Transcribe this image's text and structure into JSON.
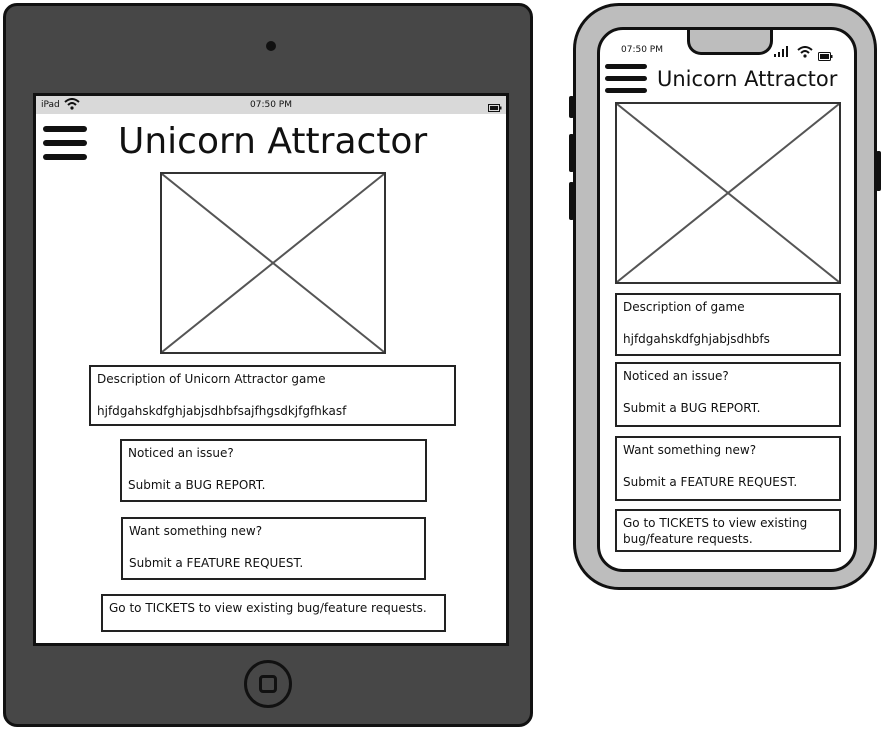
{
  "ipad": {
    "status": {
      "carrier": "iPad",
      "time": "07:50 PM"
    },
    "title": "Unicorn Attractor",
    "description": {
      "heading": "Description of Unicorn Attractor game",
      "body": "hjfdgahskdfghjabjsdhbfsajfhgsdkjfgfhkasf"
    },
    "bug": {
      "question": "Noticed an issue?",
      "action": "Submit a BUG REPORT."
    },
    "feature": {
      "question": "Want something new?",
      "action": "Submit a FEATURE REQUEST."
    },
    "tickets": {
      "text": "Go to TICKETS to view existing bug/feature requests."
    }
  },
  "phone": {
    "status": {
      "time": "07:50 PM"
    },
    "title": "Unicorn Attractor",
    "description": {
      "heading": "Description of game",
      "body": "hjfdgahskdfghjabjsdhbfs"
    },
    "bug": {
      "question": "Noticed an issue?",
      "action": "Submit a BUG REPORT."
    },
    "feature": {
      "question": "Want something new?",
      "action": "Submit a FEATURE REQUEST."
    },
    "tickets": {
      "line1": "Go to TICKETS to view existing",
      "line2": "bug/feature requests."
    }
  },
  "icons": [
    "hamburger-menu-icon",
    "wifi-icon",
    "battery-icon",
    "signal-icon",
    "image-placeholder-icon",
    "home-button-icon"
  ],
  "colors": {
    "device_dark": "#474747",
    "device_light": "#bdbdbd",
    "status_bar": "#d9d9d9",
    "ink": "#111111"
  }
}
